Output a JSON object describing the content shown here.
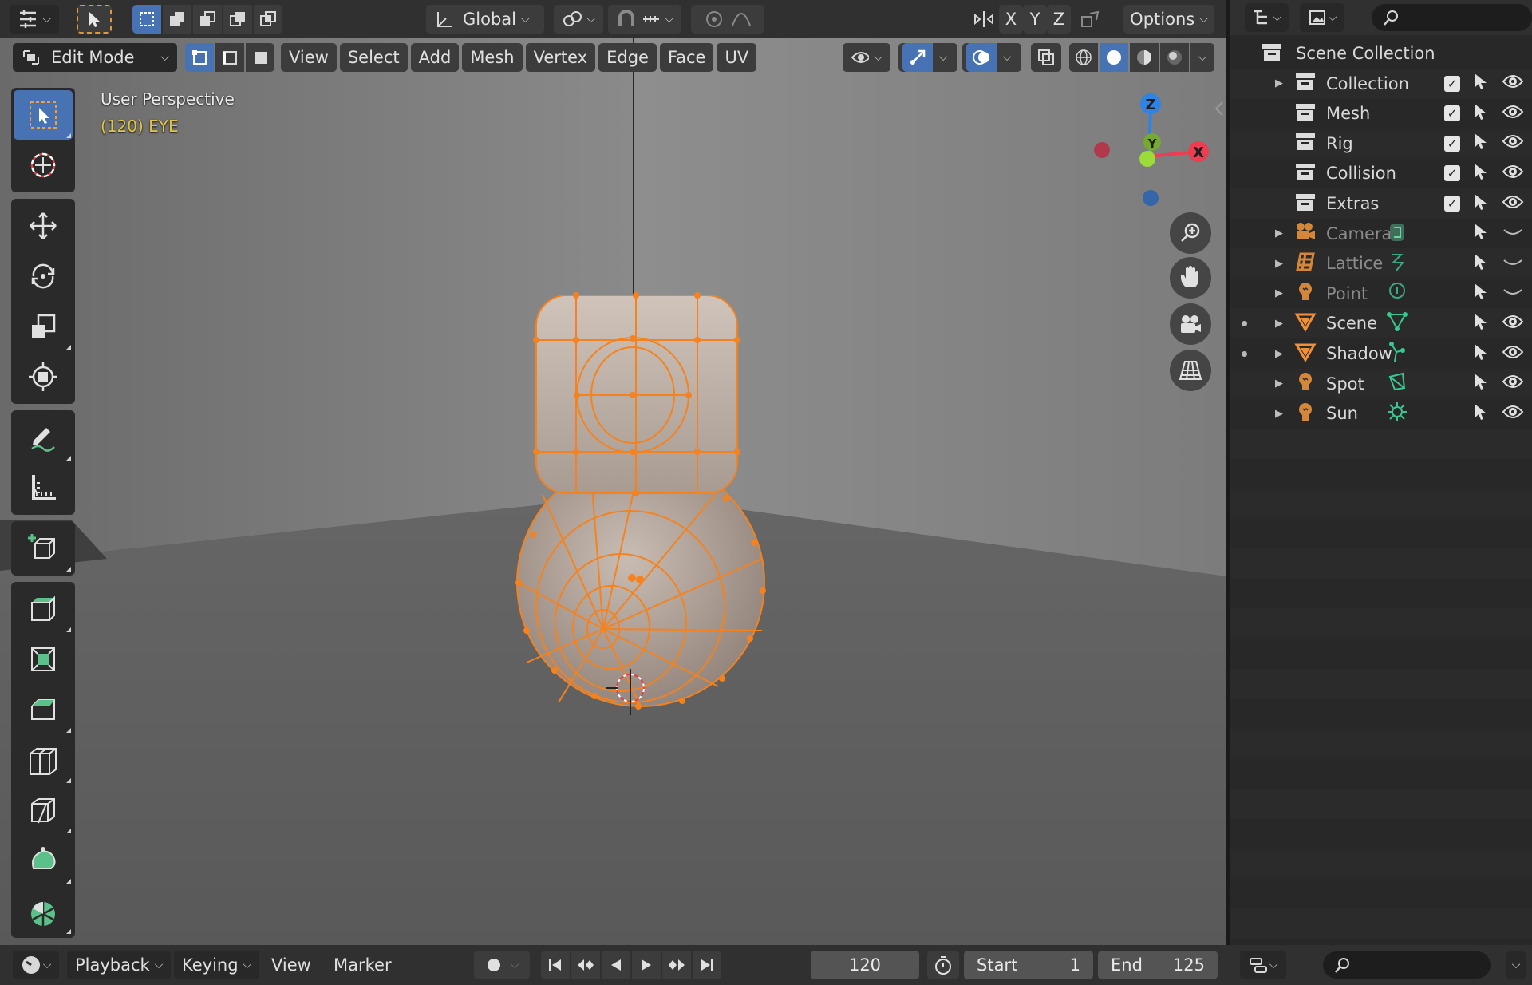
{
  "header": {
    "orientation": "Global",
    "options_label": "Options",
    "axis_x": "X",
    "axis_y": "Y",
    "axis_z": "Z"
  },
  "mode_header": {
    "mode": "Edit Mode",
    "menus": [
      "View",
      "Select",
      "Add",
      "Mesh",
      "Vertex",
      "Edge",
      "Face",
      "UV"
    ]
  },
  "viewport": {
    "title": "User Perspective",
    "subtitle": "(120) EYE",
    "gizmo": {
      "z": "Z",
      "x": "X",
      "y": "Y"
    }
  },
  "colors": {
    "selection": "#f5821e",
    "active_blue": "#4772b3",
    "axis_x": "#ec3d52",
    "axis_y": "#8bc93a",
    "axis_z": "#2f84e3",
    "scene_text_yellow": "#e2c543"
  },
  "toolbar": {
    "tools": [
      "select-box-icon",
      "cursor-icon",
      "move-icon",
      "rotate-icon",
      "scale-icon",
      "transform-icon",
      "annotate-icon",
      "measure-icon",
      "add-cube-icon",
      "extrude-icon",
      "inset-icon",
      "bevel-icon",
      "loop-cut-icon",
      "knife-icon",
      "poly-build-icon",
      "spin-icon"
    ]
  },
  "outliner": {
    "root": "Scene Collection",
    "items": [
      {
        "label": "Collection",
        "dim": false,
        "has_expander": true,
        "dot": false,
        "icon": "collection-icon",
        "checkbox": true
      },
      {
        "label": "Mesh",
        "dim": false,
        "has_expander": false,
        "dot": false,
        "icon": "collection-icon",
        "checkbox": true
      },
      {
        "label": "Rig",
        "dim": false,
        "has_expander": false,
        "dot": false,
        "icon": "collection-icon",
        "checkbox": true
      },
      {
        "label": "Collision",
        "dim": false,
        "has_expander": false,
        "dot": false,
        "icon": "collection-icon",
        "checkbox": true
      },
      {
        "label": "Extras",
        "dim": false,
        "has_expander": false,
        "dot": false,
        "icon": "collection-icon",
        "checkbox": true
      },
      {
        "label": "Camera",
        "dim": true,
        "has_expander": true,
        "dot": false,
        "icon": "camera-icon",
        "checkbox": false
      },
      {
        "label": "Lattice",
        "dim": true,
        "has_expander": true,
        "dot": false,
        "icon": "lattice-icon",
        "checkbox": false
      },
      {
        "label": "Point",
        "dim": true,
        "has_expander": true,
        "dot": false,
        "icon": "light-icon",
        "checkbox": false
      },
      {
        "label": "Scene",
        "dim": false,
        "has_expander": true,
        "dot": true,
        "icon": "mesh-object-icon",
        "checkbox": false
      },
      {
        "label": "Shadow",
        "dim": false,
        "has_expander": true,
        "dot": true,
        "icon": "mesh-object-icon",
        "checkbox": false
      },
      {
        "label": "Spot",
        "dim": false,
        "has_expander": true,
        "dot": false,
        "icon": "light-icon",
        "checkbox": false
      },
      {
        "label": "Sun",
        "dim": false,
        "has_expander": true,
        "dot": false,
        "icon": "light-icon",
        "checkbox": false
      }
    ]
  },
  "timeline": {
    "menus": [
      "Playback",
      "Keying",
      "View",
      "Marker"
    ],
    "current_frame": "120",
    "start_label": "Start",
    "start_value": "1",
    "end_label": "End",
    "end_value": "125"
  }
}
